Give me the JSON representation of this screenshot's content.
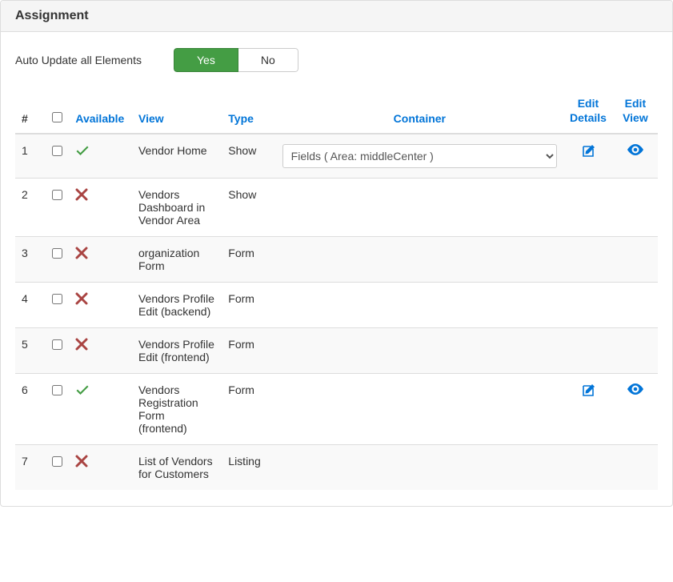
{
  "panel": {
    "title": "Assignment"
  },
  "autoUpdate": {
    "label": "Auto Update all Elements",
    "yes": "Yes",
    "no": "No"
  },
  "headers": {
    "num": "#",
    "available": "Available",
    "view": "View",
    "type": "Type",
    "container": "Container",
    "editDetails": "Edit Details",
    "editView": "Edit View"
  },
  "containerOption": "Fields ( Area: middleCenter )",
  "rows": [
    {
      "num": "1",
      "available": true,
      "view": "Vendor Home",
      "type": "Show",
      "hasContainer": true,
      "hasEdit": true
    },
    {
      "num": "2",
      "available": false,
      "view": "Vendors Dashboard in Vendor Area",
      "type": "Show",
      "hasContainer": false,
      "hasEdit": false
    },
    {
      "num": "3",
      "available": false,
      "view": "organization Form",
      "type": "Form",
      "hasContainer": false,
      "hasEdit": false
    },
    {
      "num": "4",
      "available": false,
      "view": "Vendors Profile Edit (backend)",
      "type": "Form",
      "hasContainer": false,
      "hasEdit": false
    },
    {
      "num": "5",
      "available": false,
      "view": "Vendors Profile Edit (frontend)",
      "type": "Form",
      "hasContainer": false,
      "hasEdit": false
    },
    {
      "num": "6",
      "available": true,
      "view": "Vendors Registration Form (frontend)",
      "type": "Form",
      "hasContainer": false,
      "hasEdit": true
    },
    {
      "num": "7",
      "available": false,
      "view": "List of Vendors for Customers",
      "type": "Listing",
      "hasContainer": false,
      "hasEdit": false
    }
  ]
}
